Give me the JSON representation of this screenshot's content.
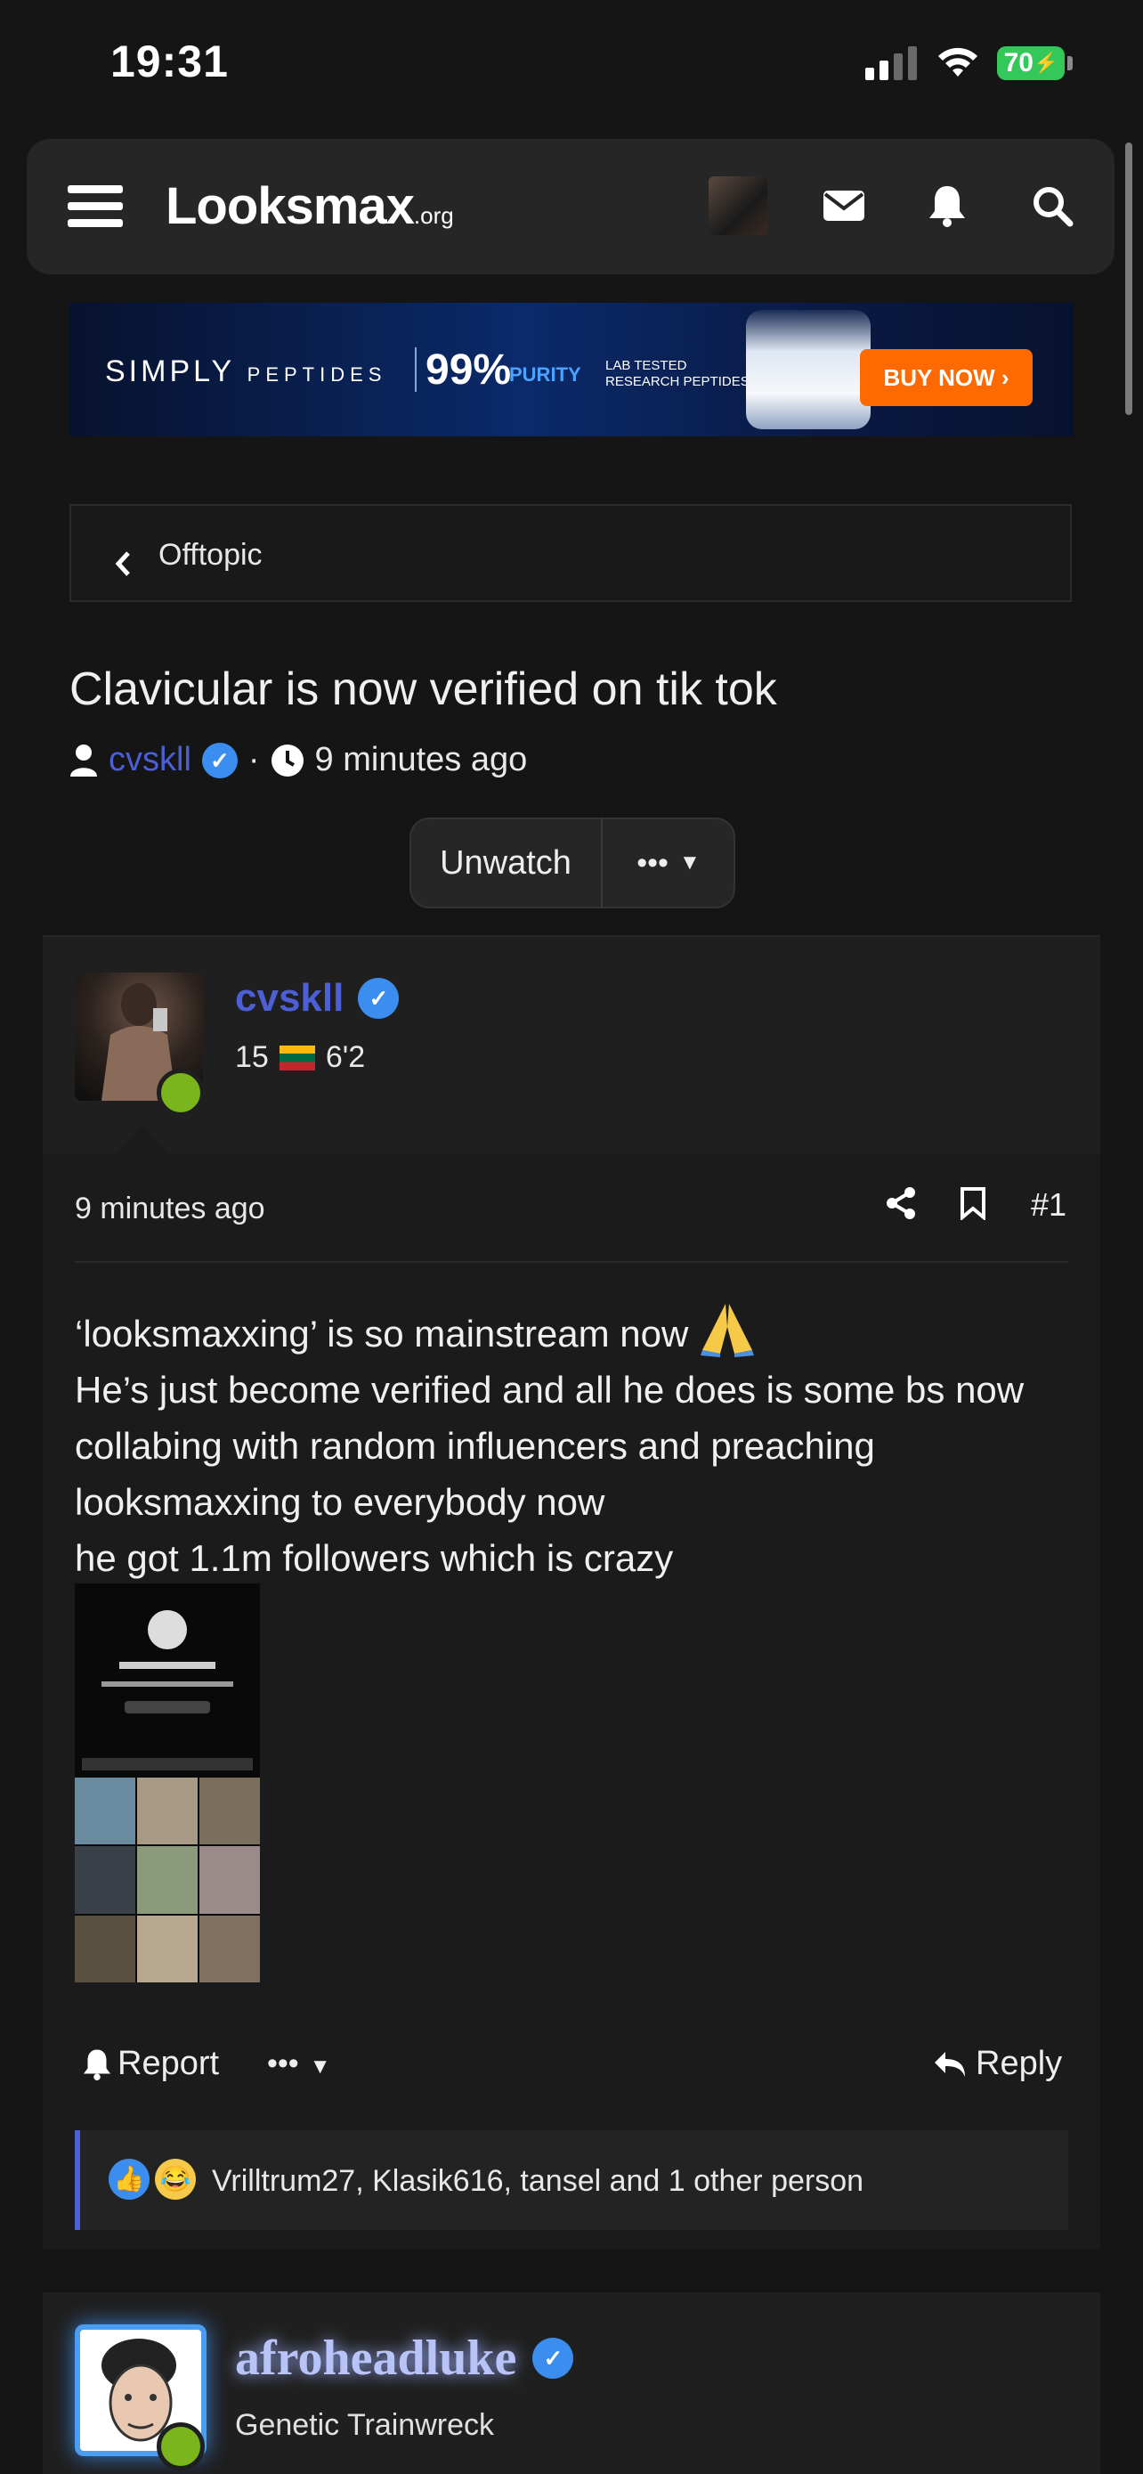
{
  "status_bar": {
    "time": "19:31",
    "battery": "70"
  },
  "header": {
    "logo_main": "Looksmax",
    "logo_suffix": ".org",
    "icons": [
      "menu-icon",
      "avatar",
      "envelope-icon",
      "bell-icon",
      "search-icon"
    ]
  },
  "ad": {
    "brand": "SIMPLY",
    "brand_sub": "PEPTIDES",
    "percent": "99%",
    "purity": "PURITY",
    "lab_line1": "LAB TESTED",
    "lab_line2": "RESEARCH PEPTIDES",
    "cta": "BUY NOW ›"
  },
  "breadcrumb": {
    "label": "Offtopic"
  },
  "thread": {
    "title": "Clavicular is now verified on tik tok",
    "author": "cvskll",
    "separator": "·",
    "time": "9 minutes ago",
    "unwatch_label": "Unwatch",
    "more_label": "•••"
  },
  "post": {
    "author": "cvskll",
    "age": "15",
    "height": "6'2",
    "time": "9 minutes ago",
    "number": "#1",
    "body_lines": [
      "‘looksmaxxing’ is so mainstream now",
      "He’s just become verified and all he does is some bs now collabing with random influencers and preaching looksmaxxing to everybody now",
      "he got 1.1m followers which is crazy"
    ],
    "report_label": "Report",
    "more_label": "•••",
    "reply_label": "Reply",
    "reactions_text": "Vrilltrum27, Klasik616, tansel and 1 other person"
  },
  "post2": {
    "author": "afroheadluke",
    "title": "Genetic Trainwreck"
  },
  "colors": {
    "accent": "#4c5fd7",
    "online": "#7ab51d",
    "verified": "#3b8ef0",
    "battery": "#34c759"
  }
}
